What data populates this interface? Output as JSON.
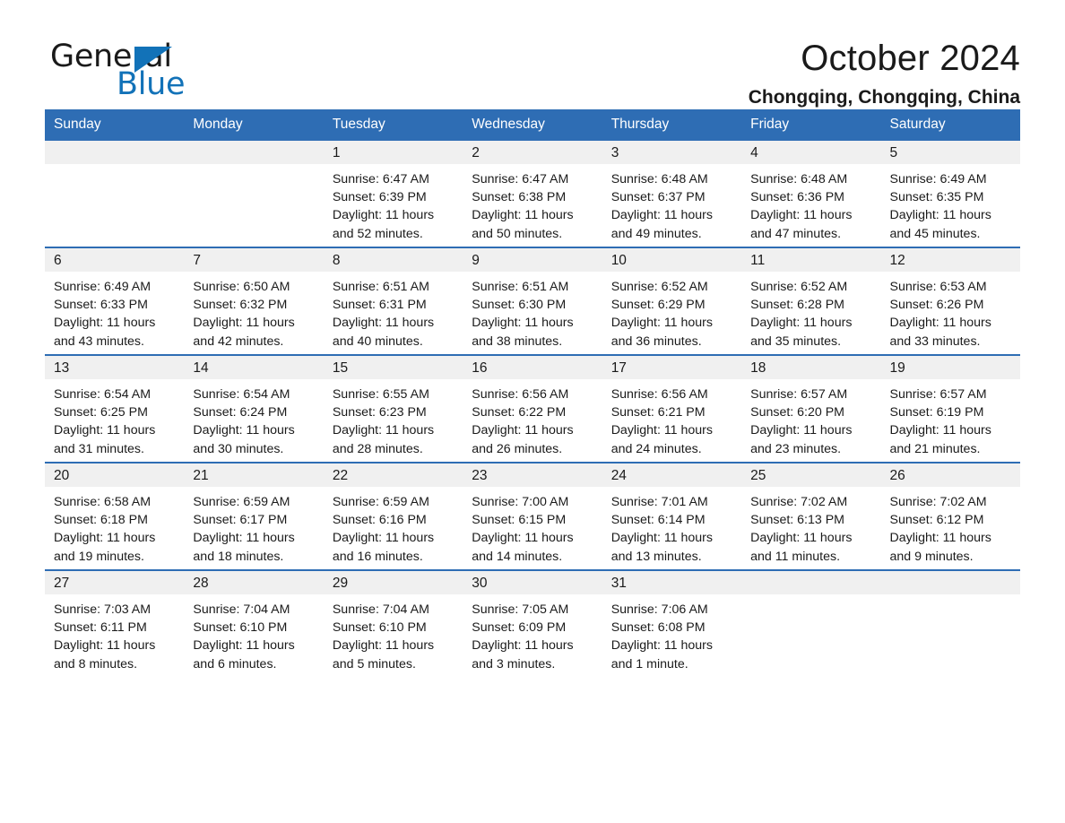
{
  "brand": {
    "word_one": "General",
    "word_two": "Blue",
    "logo_icon": "triangle-flag-icon",
    "accent_color": "#1272B8"
  },
  "header": {
    "title": "October 2024",
    "subtitle": "Chongqing, Chongqing, China"
  },
  "theme": {
    "header_blue": "#2E6DB4",
    "daynum_band": "#F0F0F0",
    "text": "#1a1a1a"
  },
  "calendar": {
    "weekday_headers": [
      "Sunday",
      "Monday",
      "Tuesday",
      "Wednesday",
      "Thursday",
      "Friday",
      "Saturday"
    ],
    "weeks": [
      [
        {
          "day": "",
          "sunrise": "",
          "sunset": "",
          "daylight_1": "",
          "daylight_2": ""
        },
        {
          "day": "",
          "sunrise": "",
          "sunset": "",
          "daylight_1": "",
          "daylight_2": ""
        },
        {
          "day": "1",
          "sunrise": "Sunrise: 6:47 AM",
          "sunset": "Sunset: 6:39 PM",
          "daylight_1": "Daylight: 11 hours",
          "daylight_2": "and 52 minutes."
        },
        {
          "day": "2",
          "sunrise": "Sunrise: 6:47 AM",
          "sunset": "Sunset: 6:38 PM",
          "daylight_1": "Daylight: 11 hours",
          "daylight_2": "and 50 minutes."
        },
        {
          "day": "3",
          "sunrise": "Sunrise: 6:48 AM",
          "sunset": "Sunset: 6:37 PM",
          "daylight_1": "Daylight: 11 hours",
          "daylight_2": "and 49 minutes."
        },
        {
          "day": "4",
          "sunrise": "Sunrise: 6:48 AM",
          "sunset": "Sunset: 6:36 PM",
          "daylight_1": "Daylight: 11 hours",
          "daylight_2": "and 47 minutes."
        },
        {
          "day": "5",
          "sunrise": "Sunrise: 6:49 AM",
          "sunset": "Sunset: 6:35 PM",
          "daylight_1": "Daylight: 11 hours",
          "daylight_2": "and 45 minutes."
        }
      ],
      [
        {
          "day": "6",
          "sunrise": "Sunrise: 6:49 AM",
          "sunset": "Sunset: 6:33 PM",
          "daylight_1": "Daylight: 11 hours",
          "daylight_2": "and 43 minutes."
        },
        {
          "day": "7",
          "sunrise": "Sunrise: 6:50 AM",
          "sunset": "Sunset: 6:32 PM",
          "daylight_1": "Daylight: 11 hours",
          "daylight_2": "and 42 minutes."
        },
        {
          "day": "8",
          "sunrise": "Sunrise: 6:51 AM",
          "sunset": "Sunset: 6:31 PM",
          "daylight_1": "Daylight: 11 hours",
          "daylight_2": "and 40 minutes."
        },
        {
          "day": "9",
          "sunrise": "Sunrise: 6:51 AM",
          "sunset": "Sunset: 6:30 PM",
          "daylight_1": "Daylight: 11 hours",
          "daylight_2": "and 38 minutes."
        },
        {
          "day": "10",
          "sunrise": "Sunrise: 6:52 AM",
          "sunset": "Sunset: 6:29 PM",
          "daylight_1": "Daylight: 11 hours",
          "daylight_2": "and 36 minutes."
        },
        {
          "day": "11",
          "sunrise": "Sunrise: 6:52 AM",
          "sunset": "Sunset: 6:28 PM",
          "daylight_1": "Daylight: 11 hours",
          "daylight_2": "and 35 minutes."
        },
        {
          "day": "12",
          "sunrise": "Sunrise: 6:53 AM",
          "sunset": "Sunset: 6:26 PM",
          "daylight_1": "Daylight: 11 hours",
          "daylight_2": "and 33 minutes."
        }
      ],
      [
        {
          "day": "13",
          "sunrise": "Sunrise: 6:54 AM",
          "sunset": "Sunset: 6:25 PM",
          "daylight_1": "Daylight: 11 hours",
          "daylight_2": "and 31 minutes."
        },
        {
          "day": "14",
          "sunrise": "Sunrise: 6:54 AM",
          "sunset": "Sunset: 6:24 PM",
          "daylight_1": "Daylight: 11 hours",
          "daylight_2": "and 30 minutes."
        },
        {
          "day": "15",
          "sunrise": "Sunrise: 6:55 AM",
          "sunset": "Sunset: 6:23 PM",
          "daylight_1": "Daylight: 11 hours",
          "daylight_2": "and 28 minutes."
        },
        {
          "day": "16",
          "sunrise": "Sunrise: 6:56 AM",
          "sunset": "Sunset: 6:22 PM",
          "daylight_1": "Daylight: 11 hours",
          "daylight_2": "and 26 minutes."
        },
        {
          "day": "17",
          "sunrise": "Sunrise: 6:56 AM",
          "sunset": "Sunset: 6:21 PM",
          "daylight_1": "Daylight: 11 hours",
          "daylight_2": "and 24 minutes."
        },
        {
          "day": "18",
          "sunrise": "Sunrise: 6:57 AM",
          "sunset": "Sunset: 6:20 PM",
          "daylight_1": "Daylight: 11 hours",
          "daylight_2": "and 23 minutes."
        },
        {
          "day": "19",
          "sunrise": "Sunrise: 6:57 AM",
          "sunset": "Sunset: 6:19 PM",
          "daylight_1": "Daylight: 11 hours",
          "daylight_2": "and 21 minutes."
        }
      ],
      [
        {
          "day": "20",
          "sunrise": "Sunrise: 6:58 AM",
          "sunset": "Sunset: 6:18 PM",
          "daylight_1": "Daylight: 11 hours",
          "daylight_2": "and 19 minutes."
        },
        {
          "day": "21",
          "sunrise": "Sunrise: 6:59 AM",
          "sunset": "Sunset: 6:17 PM",
          "daylight_1": "Daylight: 11 hours",
          "daylight_2": "and 18 minutes."
        },
        {
          "day": "22",
          "sunrise": "Sunrise: 6:59 AM",
          "sunset": "Sunset: 6:16 PM",
          "daylight_1": "Daylight: 11 hours",
          "daylight_2": "and 16 minutes."
        },
        {
          "day": "23",
          "sunrise": "Sunrise: 7:00 AM",
          "sunset": "Sunset: 6:15 PM",
          "daylight_1": "Daylight: 11 hours",
          "daylight_2": "and 14 minutes."
        },
        {
          "day": "24",
          "sunrise": "Sunrise: 7:01 AM",
          "sunset": "Sunset: 6:14 PM",
          "daylight_1": "Daylight: 11 hours",
          "daylight_2": "and 13 minutes."
        },
        {
          "day": "25",
          "sunrise": "Sunrise: 7:02 AM",
          "sunset": "Sunset: 6:13 PM",
          "daylight_1": "Daylight: 11 hours",
          "daylight_2": "and 11 minutes."
        },
        {
          "day": "26",
          "sunrise": "Sunrise: 7:02 AM",
          "sunset": "Sunset: 6:12 PM",
          "daylight_1": "Daylight: 11 hours",
          "daylight_2": "and 9 minutes."
        }
      ],
      [
        {
          "day": "27",
          "sunrise": "Sunrise: 7:03 AM",
          "sunset": "Sunset: 6:11 PM",
          "daylight_1": "Daylight: 11 hours",
          "daylight_2": "and 8 minutes."
        },
        {
          "day": "28",
          "sunrise": "Sunrise: 7:04 AM",
          "sunset": "Sunset: 6:10 PM",
          "daylight_1": "Daylight: 11 hours",
          "daylight_2": "and 6 minutes."
        },
        {
          "day": "29",
          "sunrise": "Sunrise: 7:04 AM",
          "sunset": "Sunset: 6:10 PM",
          "daylight_1": "Daylight: 11 hours",
          "daylight_2": "and 5 minutes."
        },
        {
          "day": "30",
          "sunrise": "Sunrise: 7:05 AM",
          "sunset": "Sunset: 6:09 PM",
          "daylight_1": "Daylight: 11 hours",
          "daylight_2": "and 3 minutes."
        },
        {
          "day": "31",
          "sunrise": "Sunrise: 7:06 AM",
          "sunset": "Sunset: 6:08 PM",
          "daylight_1": "Daylight: 11 hours",
          "daylight_2": "and 1 minute."
        },
        {
          "day": "",
          "sunrise": "",
          "sunset": "",
          "daylight_1": "",
          "daylight_2": ""
        },
        {
          "day": "",
          "sunrise": "",
          "sunset": "",
          "daylight_1": "",
          "daylight_2": ""
        }
      ]
    ]
  }
}
